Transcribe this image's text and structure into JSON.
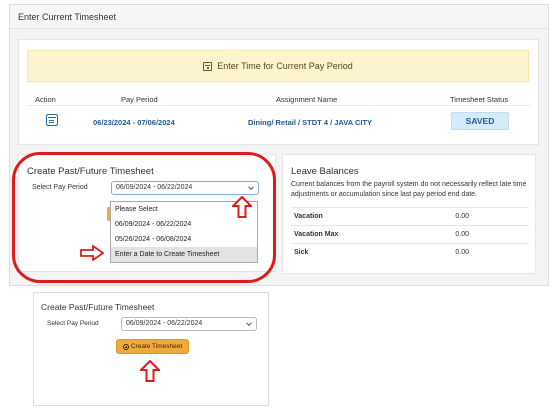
{
  "main": {
    "header_title": "Enter Current Timesheet",
    "banner": {
      "icon": "calendar-icon",
      "text": "Enter Time for Current Pay Period"
    },
    "table": {
      "headers": [
        "Action",
        "Pay Period",
        "Assignment Name",
        "Timesheet Status"
      ],
      "row": {
        "action_icon": "calendar-edit-icon",
        "pay_period": "06/23/2024 - 07/06/2024",
        "assignment": "Dining/ Retail / STDT 4 / JAVA CITY",
        "status": "SAVED"
      }
    }
  },
  "past_future": {
    "title": "Create Past/Future Timesheet",
    "label": "Select Pay Period",
    "selected": "06/09/2024 - 06/22/2024",
    "options": [
      "Please Select",
      "06/09/2024 - 06/22/2024",
      "05/26/2024 - 06/08/2024",
      "Enter a Date to Create Timesheet"
    ],
    "highlighted_option": "Enter a Date to Create Timesheet"
  },
  "leave": {
    "title": "Leave Balances",
    "description": "Current balances from the payroll system do not necessarily reflect late time adjustments or accumulation since last pay period end date.",
    "rows": [
      {
        "label": "Vacation",
        "value": "0.00"
      },
      {
        "label": "Vacation Max",
        "value": "0.00"
      },
      {
        "label": "Sick",
        "value": "0.00"
      }
    ]
  },
  "second_panel": {
    "title": "Create Past/Future Timesheet",
    "label": "Select Pay Period",
    "selected": "06/09/2024 - 06/22/2024",
    "button_label": "Create Timesheet",
    "button_icon": "plus-circle-icon"
  },
  "annotations": {
    "color": "#e01b1b"
  },
  "colors": {
    "accent_orange": "#f2a93b",
    "link_blue": "#1f5a94",
    "banner_yellow": "#fcf3cf",
    "saved_badge": "#d6ebf8"
  }
}
